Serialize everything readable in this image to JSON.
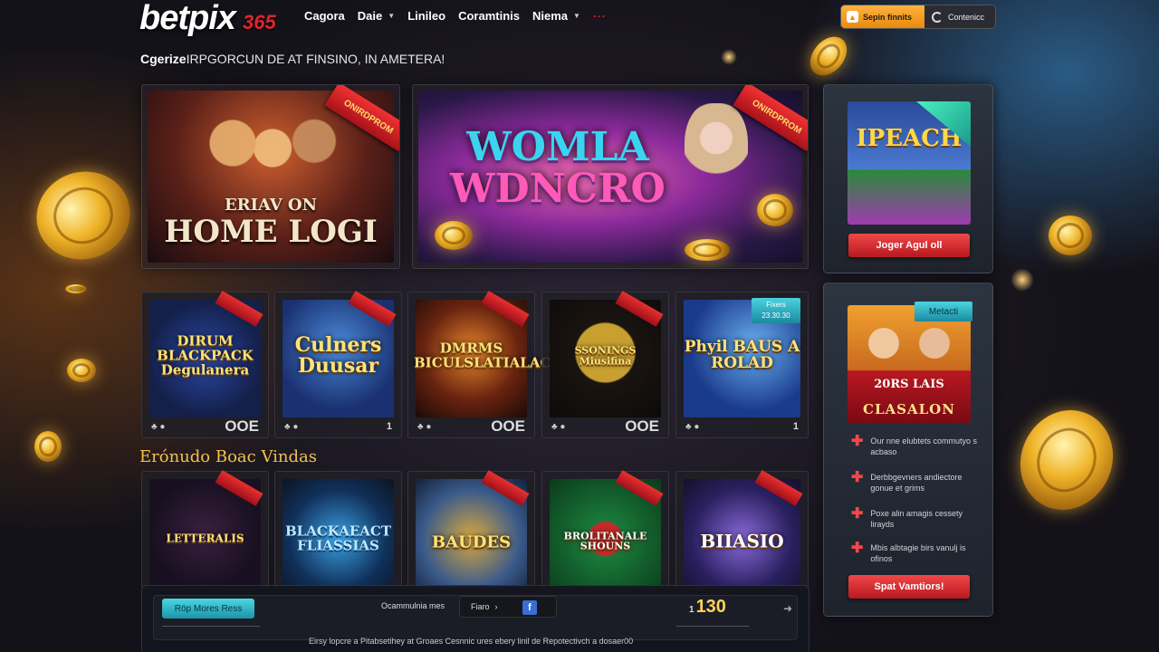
{
  "brand": {
    "logo": "betpix",
    "logo_suffix": "365"
  },
  "nav": [
    {
      "label": "Cagora"
    },
    {
      "label": "Daie",
      "dropdown": true
    },
    {
      "label": "Linileo"
    },
    {
      "label": "Coramtinis"
    },
    {
      "label": "Niema",
      "dropdown": true
    },
    {
      "label": "···"
    }
  ],
  "auth": {
    "signin_label": "Sepin finnits",
    "contact_label": "Contenicc"
  },
  "tagline": {
    "lead": "Cgerize",
    "text": "IRPGORCUN DE AT FINSINO, IN AMETERA!"
  },
  "banners": [
    {
      "title_line1": "ERIAV ON",
      "title_line2": "HOME LOGI",
      "ribbon": "ONIRDPROM"
    },
    {
      "title_line1": "WOMLA",
      "title_line2": "WDNCRO",
      "ribbon": "ONIRDPROM"
    }
  ],
  "games_top": [
    {
      "title": "DIRUM BLACKPACK Degulanera",
      "corner": "",
      "num": "OOE"
    },
    {
      "title": "Culners Duusar",
      "corner": "",
      "num": "1"
    },
    {
      "title": "DMRMS BICULSLATIALACON",
      "corner": "",
      "num": "OOE"
    },
    {
      "title": "SSONINGS Miusifina",
      "corner": "",
      "num": "OOE"
    },
    {
      "title": "Phyil BAUS A ROLAD",
      "badge": "Fixers 23.30.30",
      "num": "1"
    }
  ],
  "section_label": "Erónudo Boac Vindas",
  "games_bottom": [
    {
      "title": "LETTERALIS"
    },
    {
      "title": "BLACKAEACT FLIASSIAS"
    },
    {
      "title": "BAUDES"
    },
    {
      "title": "BROLITANALE SHOUNS"
    },
    {
      "title": "BIIASIO"
    }
  ],
  "sidebar": {
    "promo": {
      "image_title": "IPEACH",
      "cta_label": "Joger Agul oll"
    },
    "vip": {
      "badge": "Metacti",
      "image_title": "CLASALON",
      "image_sub": "20RS LAIS",
      "features": [
        "Our nne elubtets commutyo s acbaso",
        "Derbbgevners andiectore gonue et grims",
        "Poxe alin amagis cessety lirayds",
        "Mbis albtagie birs vanulj is ofinos"
      ],
      "cta_label": "Spat Vamtiors!"
    }
  },
  "footer": {
    "btn_label": "Röp Mores Ress",
    "mid_label": "Ocammulnia mes",
    "select_label": "Fiaro",
    "amount_prefix": "1",
    "amount": "130",
    "note": "Eirsy lopcre a Pitabsetihey at Groaes Cesnnic ures ebery linil de Repotectivch a dosaer00"
  },
  "colors": {
    "accent_red": "#e0242f",
    "gold": "#f2c14e",
    "teal": "#4ad6e0",
    "orange": "#ffb23e"
  }
}
